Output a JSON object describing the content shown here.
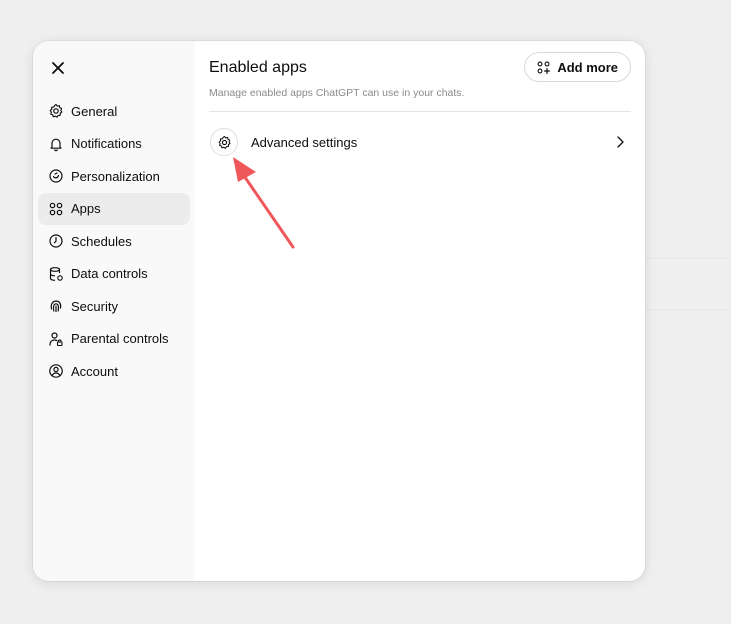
{
  "sidebar": {
    "close_label": "Close",
    "items": [
      {
        "label": "General",
        "icon": "gear-icon"
      },
      {
        "label": "Notifications",
        "icon": "bell-icon"
      },
      {
        "label": "Personalization",
        "icon": "personalization-icon"
      },
      {
        "label": "Apps",
        "icon": "apps-icon",
        "active": true
      },
      {
        "label": "Schedules",
        "icon": "clock-icon"
      },
      {
        "label": "Data controls",
        "icon": "database-icon"
      },
      {
        "label": "Security",
        "icon": "fingerprint-icon"
      },
      {
        "label": "Parental controls",
        "icon": "person-lock-icon"
      },
      {
        "label": "Account",
        "icon": "user-circle-icon"
      }
    ]
  },
  "main": {
    "title": "Enabled apps",
    "subtitle": "Manage enabled apps ChatGPT can use in your chats.",
    "add_more_label": "Add more",
    "advanced_settings_label": "Advanced settings"
  },
  "colors": {
    "annotation_arrow": "#f0575a",
    "active_item_bg": "#ececec",
    "sidebar_bg": "#f9f9f9"
  }
}
